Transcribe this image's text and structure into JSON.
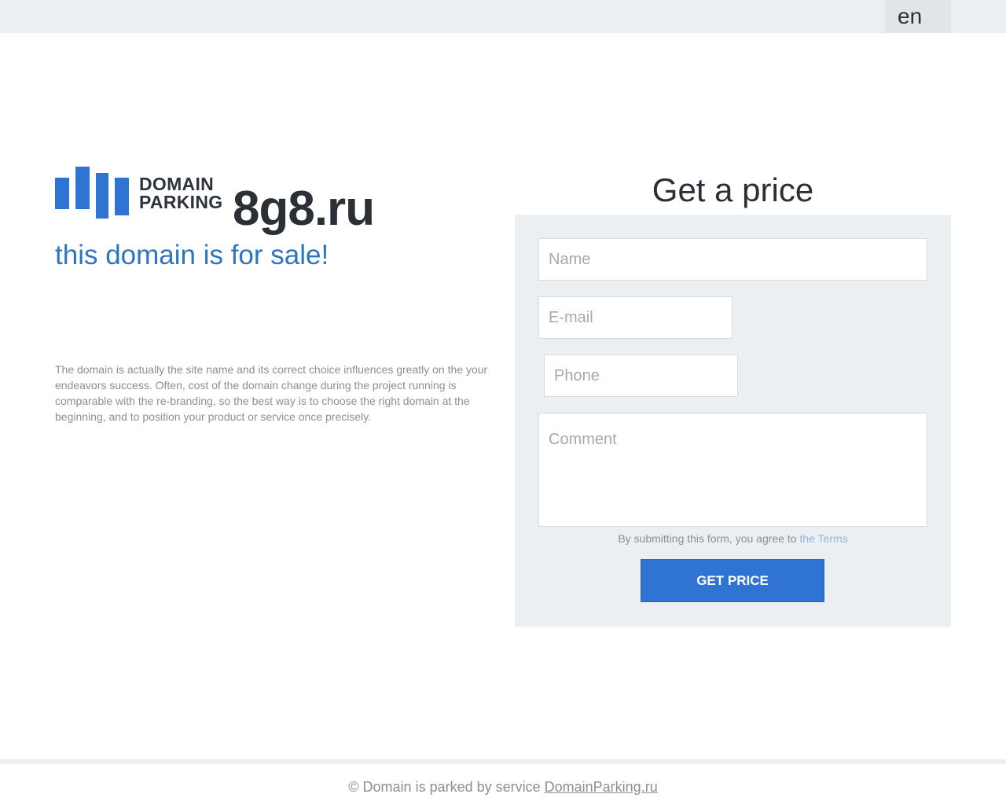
{
  "topbar": {
    "language": "en"
  },
  "logo": {
    "word1": "DOMAIN",
    "word2": "PARKING",
    "icon": "bar-chart-logo-icon",
    "color": "#2f74d3"
  },
  "hero": {
    "domain": "8g8.ru",
    "tagline": "this domain is for sale!",
    "description": "The domain is actually the site name and its correct choice influences greatly on the your endeavors success. Often, cost of the domain change during the project running is comparable with the re-branding, so the best way is to choose the right domain at the beginning, and to position your product or service once precisely."
  },
  "form": {
    "title": "Get a price",
    "name": {
      "value": "",
      "placeholder": "Name"
    },
    "email": {
      "value": "",
      "placeholder": "E-mail"
    },
    "phone": {
      "value": "",
      "placeholder": "Phone"
    },
    "comment": {
      "value": "",
      "placeholder": "Comment"
    },
    "terms_text": "By submitting this form, you agree to ",
    "terms_link": "the Terms",
    "submit_label": "GET PRICE"
  },
  "footer": {
    "text": "© Domain is parked by service ",
    "link": "DomainParking.ru"
  },
  "colors": {
    "accent": "#2f74d3",
    "tagline": "#2f74c0",
    "panel": "#eceff1",
    "link": "#8fb7e6"
  }
}
